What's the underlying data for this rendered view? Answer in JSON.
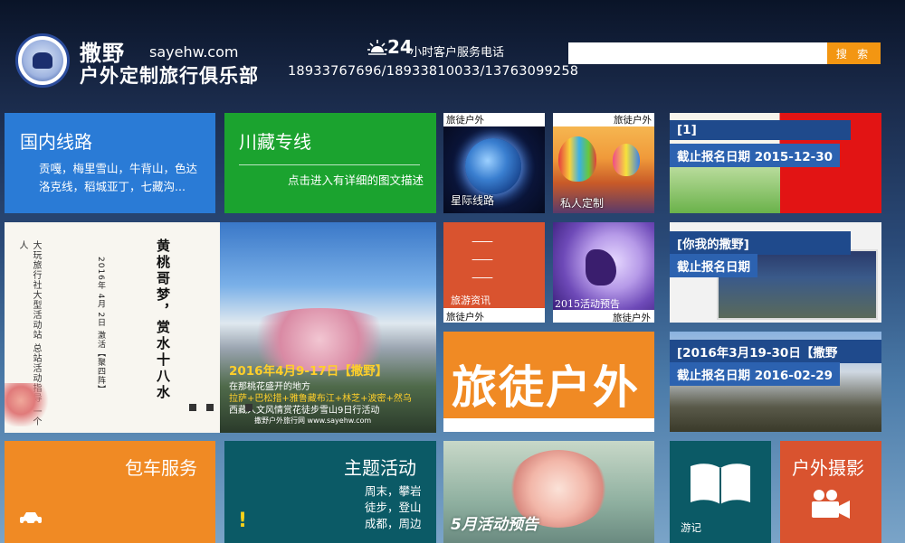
{
  "header": {
    "brand_name": "撒野",
    "brand_url": "sayehw.com",
    "brand_sub": "户外定制旅行俱乐部",
    "hotline_num": "24",
    "hotline_label": "小时客户服务电话",
    "hotline_phones": "18933767696/18933810033/13763099258",
    "search_placeholder": "",
    "search_button": "搜 索"
  },
  "tiles": {
    "domestic": {
      "title": "国内线路",
      "desc_line1": "贡嘎，梅里雪山，牛背山，色达",
      "desc_line2": "洛克线，稻城亚丁，七藏沟..."
    },
    "sichuan_tibet": {
      "title": "川藏专线",
      "desc": "点击进入有详细的图文描述"
    },
    "interstellar": {
      "brand": "旅徒户外",
      "label": "星际线路"
    },
    "private": {
      "brand": "旅徒户外",
      "label": "私人定制"
    },
    "news1": {
      "title": "[1]",
      "deadline": "截止报名日期 2015-12-30"
    },
    "travel_news": {
      "label": "旅游资讯",
      "brand": "旅徒户外",
      "dash": "——"
    },
    "preview2015": {
      "label": "2015活动预告",
      "brand": "旅徒户外"
    },
    "news2": {
      "title": "[你我的撒野]",
      "deadline": "截止报名日期"
    },
    "banner_text": "2016年4月9-17日【撒野】",
    "banner_sub1": "在那桃花盛开的地方",
    "banner_sub2": "拉萨+巴松措+雅鲁藏布江+林芝+波密+然乌",
    "banner_sub3": "西藏人文风情赏花徒步雪山9日行活动",
    "banner_footer": "撒野户外旅行网 www.sayehw.com",
    "banner_poem1": "黄桃哥梦，赏水十八水",
    "banner_poem2": "2016年 4月 2日 激活【聚四阵】",
    "banner_poem3": "大玩旅行社大型活动站 总站活动指导 一个人",
    "lutu_big": "旅徒户外",
    "news3": {
      "title": "[2016年3月19-30日【撒野",
      "deadline": "截止报名日期 2016-02-29"
    },
    "car": {
      "title": "包车服务"
    },
    "theme": {
      "title": "主题活动",
      "line1": "周末，攀岩",
      "line2": "徒步，登山",
      "line3": "成都，周边"
    },
    "may": {
      "label": "5月活动预告"
    },
    "travel_notes": {
      "label": "游记"
    },
    "photo": {
      "title": "户外摄影"
    }
  },
  "colors": {
    "blue": "#2a7bd6",
    "green": "#1ba32f",
    "orange": "#f08a24",
    "teal": "#0b5a66",
    "red": "#d9532f"
  }
}
